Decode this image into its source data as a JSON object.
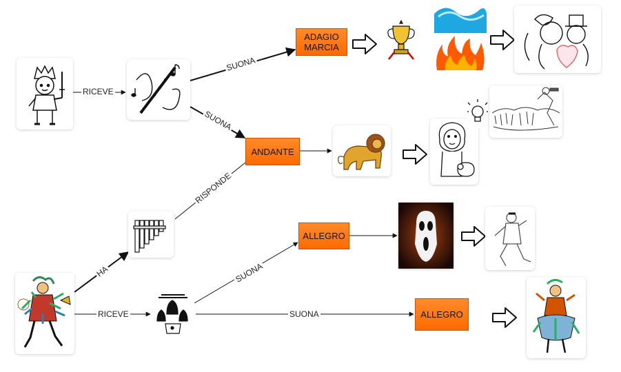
{
  "boxes": {
    "adagio": "ADAGIO\nMARCIA",
    "andante": "ANDANTE",
    "allegro_1": "ALLEGRO",
    "allegro_2": "ALLEGRO"
  },
  "links": {
    "prince_receives": "RICEVE",
    "flute_plays_adagio": "SUONA",
    "flute_plays_andante": "SUONA",
    "panflute_answers": "RISPONDE",
    "papageno_has": "HA",
    "papageno_receives": "RICEVE",
    "bells_play_allegro_1": "SUONA",
    "bells_play_allegro_2": "SUONA"
  },
  "icons": {
    "prince": "prince-icon",
    "flute": "magic-flute-icon",
    "panflute": "panflute-icon",
    "papageno": "papageno-icon",
    "bells": "glockenspiel-icon",
    "trophy": "trophy-icon",
    "water_fire": "water-fire-icon",
    "lovers": "lovers-icon",
    "lion": "lion-icon",
    "lion_lamb": "lion-lamb-icon",
    "idea": "lightbulb-icon",
    "sketch": "battle-sketch-icon",
    "scream": "ghost-mask-icon",
    "dancer": "dancer-icon",
    "papagena": "papagena-icon"
  },
  "colors": {
    "box_fill": "#ff7a10",
    "box_border": "#c85000",
    "line": "#111111"
  }
}
